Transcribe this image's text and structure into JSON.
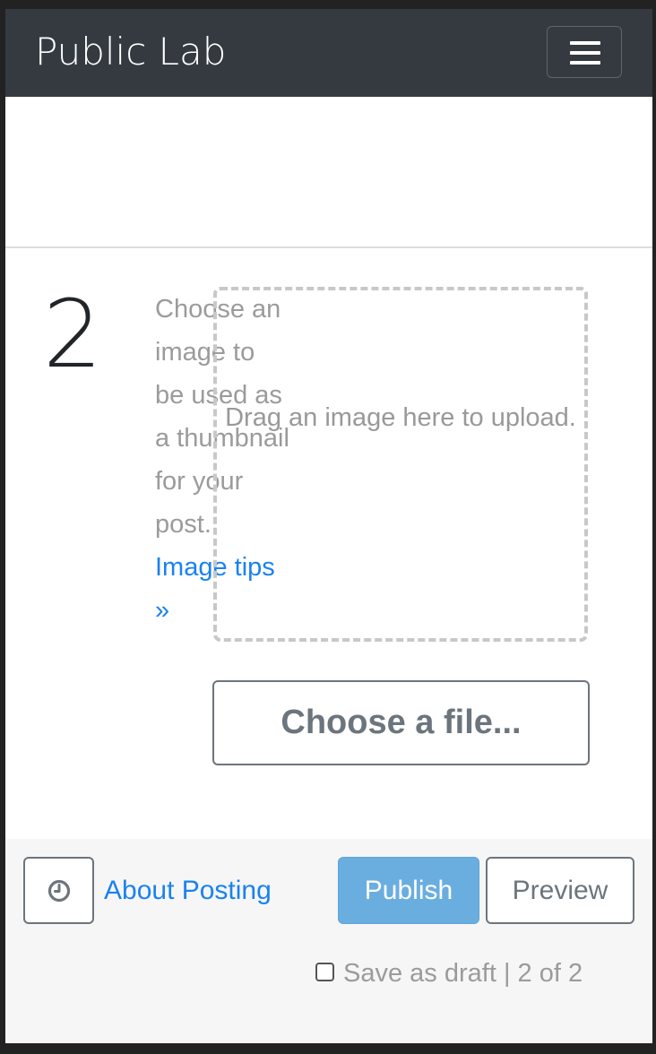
{
  "navbar": {
    "brand": "Public Lab",
    "toggle_icon": "hamburger-menu-icon"
  },
  "step": {
    "number": "2",
    "help_text": "Choose an image to be used as a thumbnail for your post.",
    "tips_link": "Image tips »"
  },
  "dropzone": {
    "text": "Drag an image here to upload."
  },
  "upload": {
    "choose_file_label": "Choose a file..."
  },
  "footer": {
    "clock_icon": "clock-icon",
    "about_link": "About Posting",
    "publish_label": "Publish",
    "preview_label": "Preview",
    "draft_label": "Save as draft",
    "page_indicator": "| 2 of 2",
    "draft_checked": false
  },
  "colors": {
    "navbar_bg": "#343a40",
    "link": "#1a82f0",
    "publish_bg": "#6aaee0",
    "muted_text": "#9b9b9b",
    "footer_bg": "#f6f6f6"
  }
}
